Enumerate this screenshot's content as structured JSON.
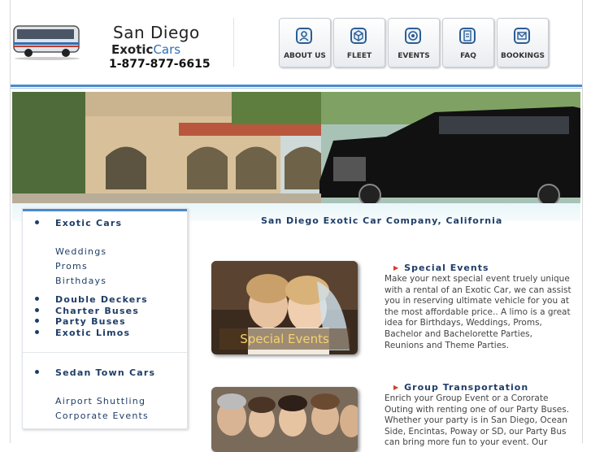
{
  "header": {
    "logo_title": "San Diego",
    "logo_sub_a": "Exotic",
    "logo_sub_b": "Cars",
    "phone": "1-877-877-6615"
  },
  "nav": [
    {
      "label": "ABOUT US",
      "icon": "person-icon"
    },
    {
      "label": "FLEET",
      "icon": "box-icon"
    },
    {
      "label": "EVENTS",
      "icon": "target-icon"
    },
    {
      "label": "FAQ",
      "icon": "document-icon"
    },
    {
      "label": "BOOKINGS",
      "icon": "envelope-icon"
    }
  ],
  "tagline": "San Diego Exotic Car Company, California",
  "sidebar": {
    "exotic_cars": "Exotic Cars",
    "weddings": "Weddings",
    "proms": "Proms",
    "birthdays": "Birthdays",
    "double_deckers": "Double Deckers",
    "charter_buses": "Charter Buses",
    "party_buses": "Party Buses",
    "exotic_limos": "Exotic Limos",
    "sedan_town_cars": "Sedan Town Cars",
    "airport_shuttling": "Airport Shuttling",
    "corporate_events": "Corporate Events"
  },
  "sections": {
    "special_events": {
      "title": "Special Events",
      "photo_caption": "Special Events",
      "body": "Make your next special event truely unique with a rental of an Exotic Car, we can assist you in reserving ultimate vehicle for you at the most affordable price.. A limo is a great idea for Birthdays, Weddings, Proms, Bachelor and Bachelorette Parties, Reunions and Theme Parties."
    },
    "group_transportation": {
      "title": "Group Transportation",
      "body": "Enrich your Group Event or a Cororate Outing with renting one of our Party Buses. Whether your party is in San Diego, Ocean Side, Encintas, Poway or SD, our Party Bus can bring more fun to your event. Our"
    }
  },
  "colors": {
    "accent_blue": "#4b8ac9",
    "nav_text_blue": "#1f3d66",
    "arrow_red": "#d43c2a"
  }
}
